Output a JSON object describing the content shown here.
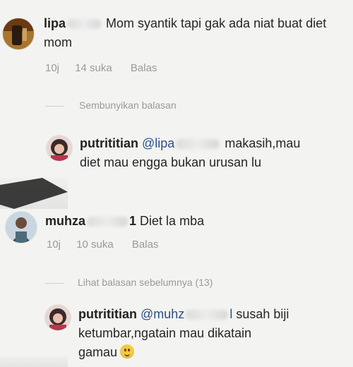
{
  "comments": [
    {
      "username": "lipa",
      "text": "Mom syantik tapi gak ada niat buat diet mom",
      "time": "10j",
      "likes": "14 suka",
      "reply_label": "Balas"
    },
    {
      "username": "muhza",
      "username_tail": "1",
      "text": "Diet la mba",
      "time": "10j",
      "likes": "10 suka",
      "reply_label": "Balas"
    }
  ],
  "threads": [
    {
      "toggle_label": "Sembunyikan balasan",
      "reply": {
        "username": "putrititian",
        "mention": "@lipa",
        "text": "makasih,mau diet mau engga bukan urusan lu"
      }
    },
    {
      "toggle_label": "Lihat balasan sebelumnya (13)",
      "reply": {
        "username": "putrititian",
        "mention": "@muhz",
        "mention_tail": "l",
        "text_line1": "susah biji",
        "text_line2": "ketumbar,ngatain mau dikatain",
        "text_line3": "gamau"
      }
    }
  ],
  "colors": {
    "background": "#f3f3f1",
    "text": "#262626",
    "muted": "#9a9a9a",
    "mention": "#2b4f86"
  },
  "icons": {
    "emoji": "worried-face-emoji"
  }
}
